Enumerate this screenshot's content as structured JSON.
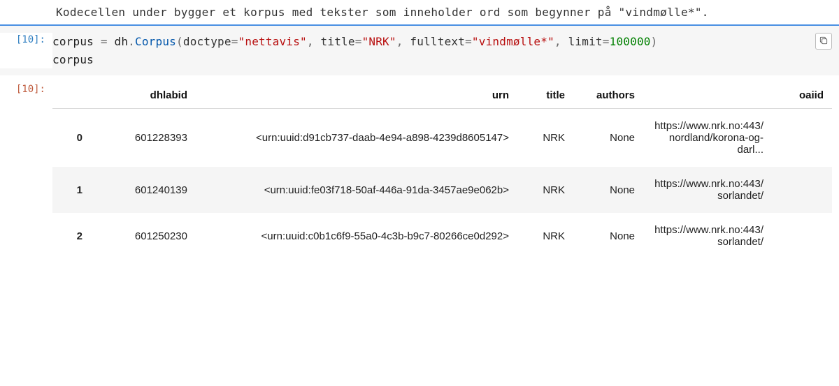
{
  "markdown": {
    "text": "Kodecellen under bygger et korpus med tekster som inneholder ord som begynner på \"vindmølle*\"."
  },
  "code_cell": {
    "prompt": "[10]:",
    "tokens": {
      "var1": "corpus",
      "eq": " = ",
      "mod": "dh",
      "dot": ".",
      "cls": "Corpus",
      "lpar": "(",
      "k1": "doctype",
      "asg": "=",
      "v1": "\"nettavis\"",
      "com": ", ",
      "k2": "title",
      "v2": "\"NRK\"",
      "k3": "fulltext",
      "v3": "\"vindmølle*\"",
      "k4": "limit",
      "v4": "100000",
      "rpar": ")",
      "line2": "corpus"
    }
  },
  "output": {
    "prompt": "[10]:",
    "table": {
      "headers": {
        "idx": " ",
        "dhlabid": "dhlabid",
        "urn": "urn",
        "title": "title",
        "authors": "authors",
        "oaiid": "oaiid"
      },
      "rows": [
        {
          "idx": "0",
          "dhlabid": "601228393",
          "urn": "<urn:uuid:d91cb737-daab-4e94-a898-4239d8605147>",
          "title": "NRK",
          "authors": "None",
          "oaiid": "https://www.nrk.no:443/nordland/korona-og-darl..."
        },
        {
          "idx": "1",
          "dhlabid": "601240139",
          "urn": "<urn:uuid:fe03f718-50af-446a-91da-3457ae9e062b>",
          "title": "NRK",
          "authors": "None",
          "oaiid": "https://www.nrk.no:443/sorlandet/"
        },
        {
          "idx": "2",
          "dhlabid": "601250230",
          "urn": "<urn:uuid:c0b1c6f9-55a0-4c3b-b9c7-80266ce0d292>",
          "title": "NRK",
          "authors": "None",
          "oaiid": "https://www.nrk.no:443/sorlandet/"
        }
      ]
    }
  }
}
